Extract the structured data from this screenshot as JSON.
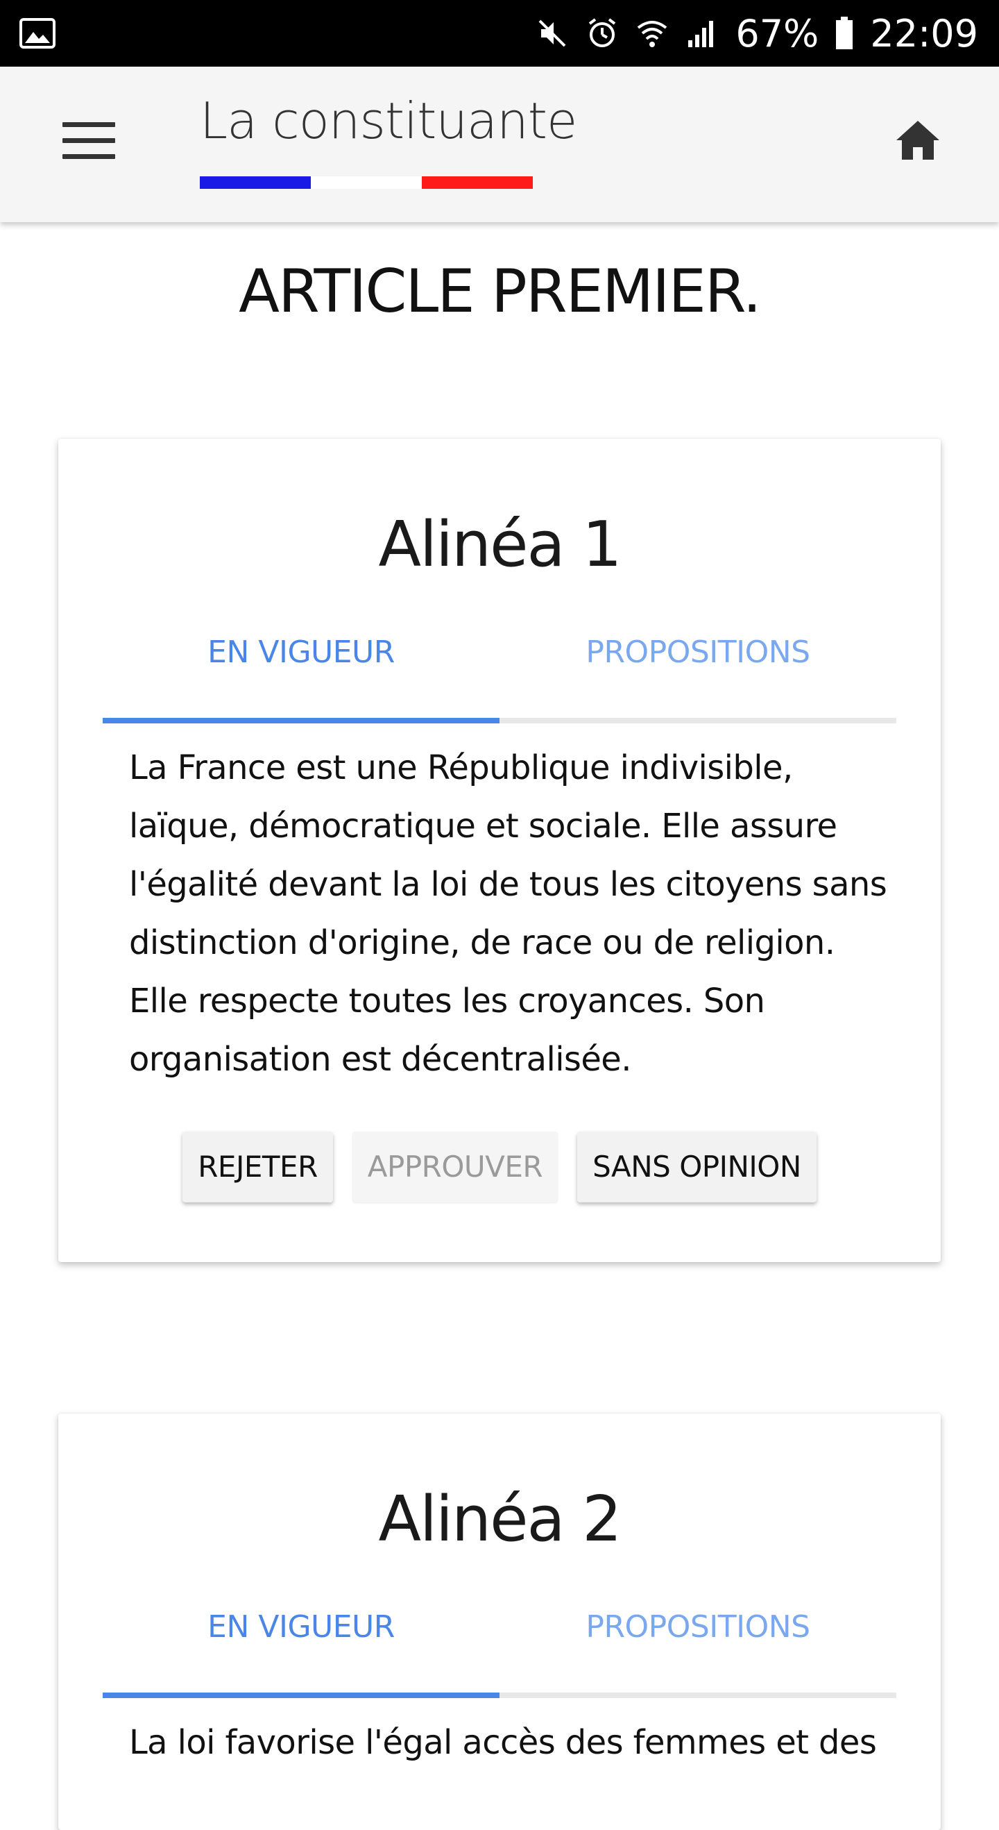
{
  "status_bar": {
    "battery_percent": "67%",
    "time": "22:09",
    "icons": [
      "image-icon",
      "mute-icon",
      "alarm-icon",
      "wifi-icon",
      "signal-icon",
      "battery-icon"
    ]
  },
  "app_bar": {
    "title": "La constituante",
    "flag_colors": [
      "#1a1ae6",
      "#ffffff",
      "#ff1a1a"
    ],
    "menu_icon": "hamburger-icon",
    "home_icon": "home-icon"
  },
  "page": {
    "title": "ARTICLE PREMIER."
  },
  "cards": [
    {
      "title": "Alinéa 1",
      "tabs": [
        "EN VIGUEUR",
        "PROPOSITIONS"
      ],
      "active_tab": 0,
      "text": "La France est une République indivisible, laïque, démocratique et sociale. Elle assure l'égalité devant la loi de tous les citoyens sans distinction d'origine, de race ou de religion. Elle respecte toutes les croyances. Son organisation est décentralisée.",
      "buttons": {
        "reject": "REJETER",
        "approve": "APPROUVER",
        "no_opinion": "SANS OPINION"
      },
      "approve_disabled": true
    },
    {
      "title": "Alinéa 2",
      "tabs": [
        "EN VIGUEUR",
        "PROPOSITIONS"
      ],
      "active_tab": 0,
      "text": "La loi favorise l'égal accès des femmes et des"
    }
  ],
  "colors": {
    "accent": "#4a86e8",
    "appbar_bg": "#f5f5f5"
  }
}
